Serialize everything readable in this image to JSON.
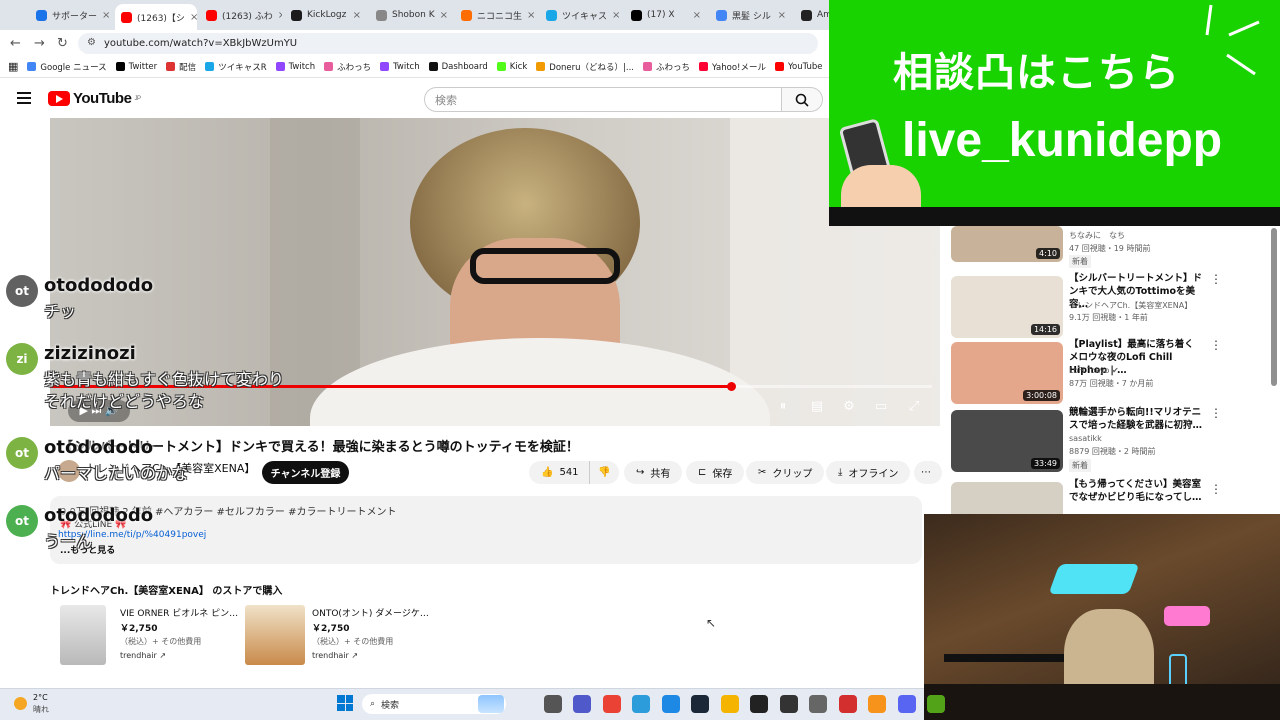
{
  "browser": {
    "tabs": [
      {
        "label": "サポーター",
        "color": "#1a73e8"
      },
      {
        "label": "(1263)【シ",
        "color": "#ff0000"
      },
      {
        "label": "(1263) ふわ",
        "color": "#ff0000"
      },
      {
        "label": "KickLogz",
        "color": "#1b1b1b"
      },
      {
        "label": "Shobon K",
        "color": "#888888"
      },
      {
        "label": "ニコニコ生",
        "color": "#ff6d00"
      },
      {
        "label": "ツイキャス",
        "color": "#1aa7e8"
      },
      {
        "label": "(17) X",
        "color": "#000000"
      },
      {
        "label": "黒髪 シル",
        "color": "#4285f4"
      },
      {
        "label": "Ama",
        "color": "#222222"
      }
    ],
    "url": "youtube.com/watch?v=XBkJbWzUmYU",
    "bookmarks": [
      "Google ニュース",
      "Twitter",
      "配信",
      "ツイキャスR",
      "Twitch",
      "ふわっち",
      "Twitch",
      "Dashboard",
      "Kick",
      "Doneru（どねる）|...",
      "ふわっち",
      "Yahoo!メール",
      "YouTube",
      "ちくラン"
    ]
  },
  "youtube": {
    "logo": "YouTube",
    "logo_region": "JP",
    "search_placeholder": "検索",
    "video_title": "【シルバートリートメント】ドンキで買える！最強に染まるとう噂のトッティモを検証！",
    "channel": "トレンドヘアCh.【美容室XENA】",
    "subscribe": "チャンネル登録",
    "likes": "541",
    "share": "共有",
    "save": "保存",
    "clip": "クリップ",
    "offline": "オフライン",
    "more": "⋯",
    "desc_line1": "9.0万 回視聴  2 年前  #ヘアカラー #セルフカラー #カラートリートメント",
    "desc_line2": "🎀 公式LINE 🎀",
    "desc_link": "https://line.me/ti/p/%40491povej",
    "desc_more": "...もっと見る",
    "store_heading": "トレンドヘアCh.【美容室XENA】 のストアで購入",
    "products": [
      {
        "name": "VIE ORNER ビオルネ ピン…",
        "price": "￥2,750",
        "tax": "（税込）+ その他費用",
        "shop": "trendhair ↗"
      },
      {
        "name": "ONTO(オント) ダメージケ…",
        "price": "￥2,750",
        "tax": "（税込）+ その他費用",
        "shop": "trendhair ↗"
      }
    ]
  },
  "chat": [
    {
      "avatar": "ot",
      "color": "#616161",
      "name": "otodododo",
      "msg": "チッ"
    },
    {
      "avatar": "zi",
      "color": "#7cb342",
      "name": "zizizinozi",
      "msg": "紫も青も紺もすぐ色抜けて変わりそれだけどどうやろな"
    },
    {
      "avatar": "ot",
      "color": "#7cb342",
      "name": "otodododo",
      "msg": "パーマしたいのかな"
    },
    {
      "avatar": "ot",
      "color": "#4caf50",
      "name": "otodododo",
      "msg": "うーん"
    }
  ],
  "banner": {
    "line1": "相談凸はこちら",
    "line2": "live_kunidepp"
  },
  "sidebar": [
    {
      "title": "ちなみに　なち",
      "meta1": "47 回視聴・19 時間前",
      "badge": "新着",
      "dur": "4:10",
      "color": "#c9b29a"
    },
    {
      "title": "【シルバートリートメント】ドンキで大人気のTottimoを美容…",
      "meta1": "トレンドヘアCh.【美容室XENA】",
      "meta2": "9.1万 回視聴・1 年前",
      "dur": "14:16",
      "color": "#e8e0d4"
    },
    {
      "title": "【Playlist】最高に落ち着くメロウな夜のLofi Chill Hiphop | …",
      "meta1": "LoFi Tokyo ✔",
      "meta2": "87万 回視聴・7 か月前",
      "dur": "3:00:08",
      "color": "#e4a78c"
    },
    {
      "title": "競輪選手から転向!!マリオテニスで培った経験を武器に初狩…",
      "meta1": "sasatikk",
      "meta2": "8879 回視聴・2 時間前",
      "badge": "新着",
      "dur": "33:49",
      "color": "#4a4a4a"
    },
    {
      "title": "【もう帰ってください】美容室でなぜかビビり毛になってし…",
      "meta1": "",
      "dur": "",
      "color": "#d6cfc4"
    }
  ],
  "taskbar": {
    "weather_temp": "2°C",
    "weather_desc": "晴れ",
    "search": "検索"
  }
}
